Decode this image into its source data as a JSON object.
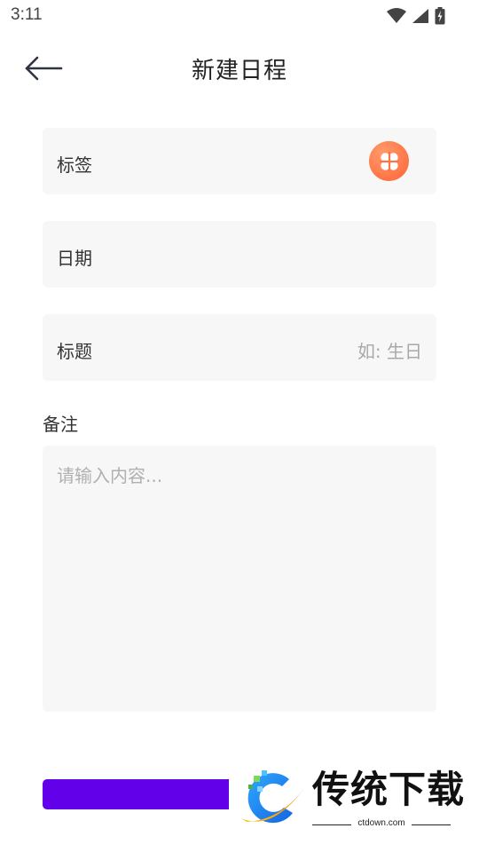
{
  "status_bar": {
    "time": "3:11",
    "icons": [
      "wifi-icon",
      "cellular-signal-icon",
      "battery-charging-icon"
    ]
  },
  "app_bar": {
    "back_icon": "arrow-left-icon",
    "title": "新建日程"
  },
  "form": {
    "tag": {
      "label": "标签",
      "icon": "clover-icon",
      "icon_color": "#ff7446"
    },
    "date": {
      "label": "日期",
      "value": ""
    },
    "title": {
      "label": "标题",
      "placeholder": "如: 生日"
    },
    "notes": {
      "label": "备注",
      "placeholder": "请输入内容..."
    },
    "submit": {
      "label": "",
      "color": "#6200ea"
    }
  },
  "watermark": {
    "text": "传统下载",
    "url": "ctdown.com"
  },
  "colors": {
    "field_background": "#f7f7f7",
    "placeholder": "#a8a8a8"
  }
}
